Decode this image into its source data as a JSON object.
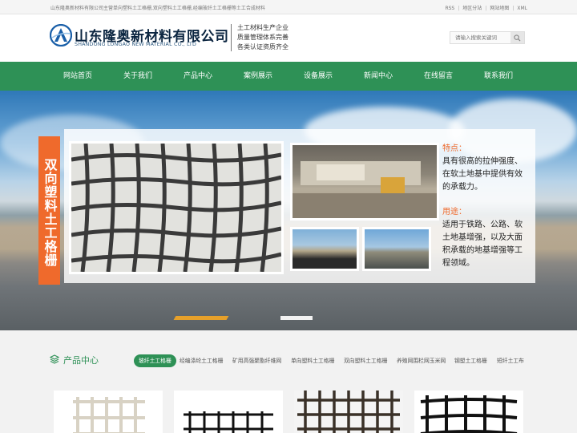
{
  "topbar": {
    "intro": "山东隆奥新材料有限公司主营单向塑料土工格栅,双向塑料土工格栅,经编玻纤土工格栅等土工合成材料",
    "links": [
      "RSS",
      "地区分站",
      "网站地图",
      "XML"
    ]
  },
  "header": {
    "company_cn": "山东隆奥新材料有限公司",
    "company_en": "SHANDONG LONGAO NEW MATERIAL CO., LTD",
    "slogan": [
      "土工材料生产企业",
      "质量管理体系完善",
      "各类认证资质齐全"
    ],
    "search_placeholder": "请输入搜索关键词",
    "search_icon": "search-icon"
  },
  "nav": [
    "网站首页",
    "关于我们",
    "产品中心",
    "案例展示",
    "设备展示",
    "新闻中心",
    "在线留言",
    "联系我们"
  ],
  "banner": {
    "vertical_title": "双向塑料土工格栅",
    "feature_heading": "特点：",
    "feature_text": "具有很高的拉伸强度、在软土地基中提供有效的承载力。",
    "usage_heading": "用途：",
    "usage_text": "适用于铁路、公路、软土地基增强，以及大面积承载的地基增强等工程领域。"
  },
  "products": {
    "title": "产品中心",
    "tabs": [
      "玻纤土工格栅",
      "经编涤纶土工格栅",
      "矿用高强聚酯纤维网",
      "单向塑料土工格栅",
      "双向塑料土工格栅",
      "养殖网围栏网玉米网",
      "钢塑土工格栅",
      "短纤土工布"
    ],
    "active_tab": 0
  },
  "colors": {
    "brand_green": "#2e9156",
    "accent_orange": "#ef6a2c",
    "logo_navy": "#0b2540"
  }
}
